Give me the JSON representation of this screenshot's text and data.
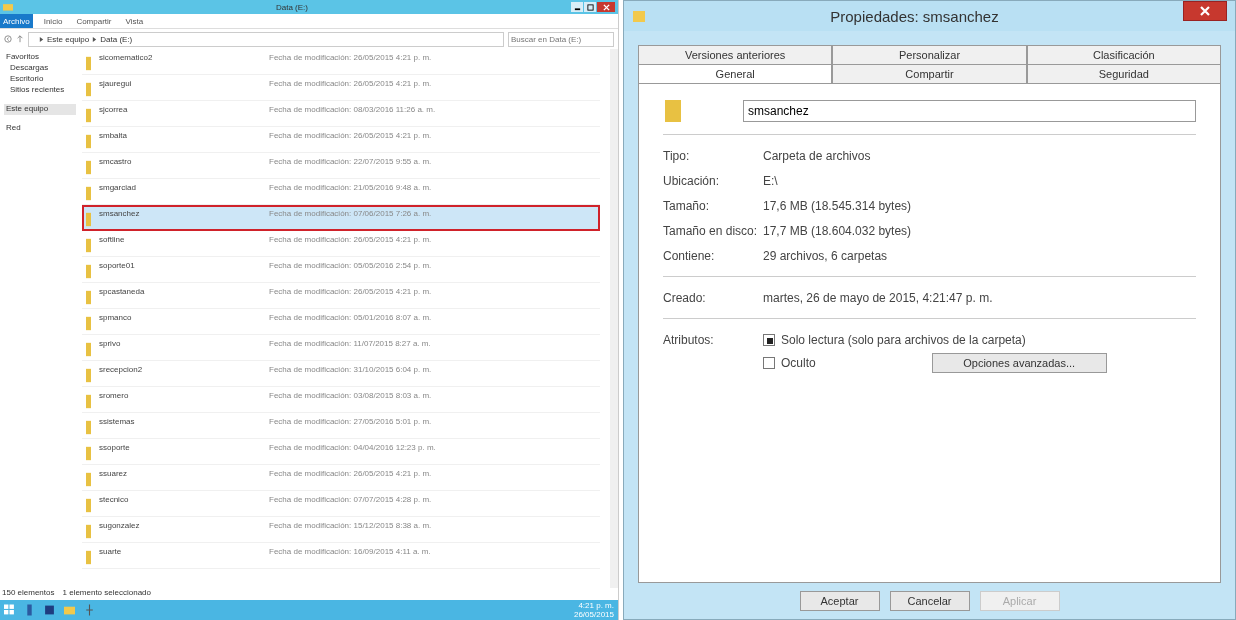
{
  "explorer": {
    "window": {
      "title": "Data (E:)"
    },
    "ribbon_tabs": [
      {
        "label": "Archivo",
        "selected": true
      },
      {
        "label": "Inicio",
        "selected": false
      },
      {
        "label": "Compartir",
        "selected": false
      },
      {
        "label": "Vista",
        "selected": false
      }
    ],
    "breadcrumb": [
      "Este equipo",
      "Data (E:)"
    ],
    "search": {
      "placeholder": "Buscar en Data (E:)"
    },
    "sidebar": {
      "items": [
        {
          "label": "Favoritos",
          "children": [
            {
              "label": "Descargas"
            },
            {
              "label": "Escritorio"
            },
            {
              "label": "Sitios recientes"
            }
          ]
        },
        {
          "label": "Este equipo",
          "selected": true
        },
        {
          "label": "Red",
          "selected": false
        }
      ]
    },
    "files": [
      {
        "name": "sicomematico2",
        "modified": "Fecha de modificación: 26/05/2015 4:21 p. m.",
        "selected": false
      },
      {
        "name": "sjauregui",
        "modified": "Fecha de modificación: 26/05/2015 4:21 p. m.",
        "selected": false
      },
      {
        "name": "sjcorrea",
        "modified": "Fecha de modificación: 08/03/2016 11:26 a. m.",
        "selected": false
      },
      {
        "name": "smbalta",
        "modified": "Fecha de modificación: 26/05/2015 4:21 p. m.",
        "selected": false
      },
      {
        "name": "smcastro",
        "modified": "Fecha de modificación: 22/07/2015 9:55 a. m.",
        "selected": false
      },
      {
        "name": "smgarciad",
        "modified": "Fecha de modificación: 21/05/2016 9:48 a. m.",
        "selected": false
      },
      {
        "name": "smsanchez",
        "modified": "Fecha de modificación: 07/06/2015 7:26 a. m.",
        "selected": true
      },
      {
        "name": "softline",
        "modified": "Fecha de modificación: 26/05/2015 4:21 p. m.",
        "selected": false
      },
      {
        "name": "soporte01",
        "modified": "Fecha de modificación: 05/05/2016 2:54 p. m.",
        "selected": false
      },
      {
        "name": "spcastaneda",
        "modified": "Fecha de modificación: 26/05/2015 4:21 p. m.",
        "selected": false
      },
      {
        "name": "spmanco",
        "modified": "Fecha de modificación: 05/01/2016 8:07 a. m.",
        "selected": false
      },
      {
        "name": "sprivo",
        "modified": "Fecha de modificación: 11/07/2015 8:27 a. m.",
        "selected": false
      },
      {
        "name": "srecepcion2",
        "modified": "Fecha de modificación: 31/10/2015 6:04 p. m.",
        "selected": false
      },
      {
        "name": "sromero",
        "modified": "Fecha de modificación: 03/08/2015 8:03 a. m.",
        "selected": false
      },
      {
        "name": "ssistemas",
        "modified": "Fecha de modificación: 27/05/2016 5:01 p. m.",
        "selected": false
      },
      {
        "name": "ssoporte",
        "modified": "Fecha de modificación: 04/04/2016 12:23 p. m.",
        "selected": false
      },
      {
        "name": "ssuarez",
        "modified": "Fecha de modificación: 26/05/2015 4:21 p. m.",
        "selected": false
      },
      {
        "name": "stecnico",
        "modified": "Fecha de modificación: 07/07/2015 4:28 p. m.",
        "selected": false
      },
      {
        "name": "sugonzalez",
        "modified": "Fecha de modificación: 15/12/2015 8:38 a. m.",
        "selected": false
      },
      {
        "name": "suarte",
        "modified": "Fecha de modificación: 16/09/2015 4:11 a. m.",
        "selected": false
      }
    ],
    "status_bar": [
      "150 elementos",
      "1 elemento seleccionado"
    ],
    "tray": {
      "time": "4:21 p. m.",
      "date": "26/05/2015"
    }
  },
  "dialog": {
    "title": "Propiedades: smsanchez",
    "tab_rows": [
      [
        {
          "label": "Versiones anteriores",
          "selected": false
        },
        {
          "label": "Personalizar",
          "selected": false
        },
        {
          "label": "Clasificación",
          "selected": false
        }
      ],
      [
        {
          "label": "General",
          "selected": true
        },
        {
          "label": "Compartir",
          "selected": false
        },
        {
          "label": "Seguridad",
          "selected": false
        }
      ]
    ],
    "name_field": {
      "value": "smsanchez"
    },
    "groups": [
      [
        {
          "label": "Tipo:",
          "value": "Carpeta de archivos"
        },
        {
          "label": "Ubicación:",
          "value": "E:\\"
        },
        {
          "label": "Tamaño:",
          "value": "17,6 MB (18.545.314 bytes)"
        },
        {
          "label": "Tamaño en disco:",
          "value": "17,7 MB (18.604.032 bytes)"
        },
        {
          "label": "Contiene:",
          "value": "29 archivos, 6 carpetas"
        }
      ],
      [
        {
          "label": "Creado:",
          "value": "martes, 26 de mayo de 2015, 4:21:47 p. m."
        }
      ]
    ],
    "attributes": {
      "label": "Atributos:",
      "items": [
        {
          "label": "Solo lectura (solo para archivos de la carpeta)",
          "checked": true
        },
        {
          "label": "Oculto",
          "checked": false
        }
      ],
      "advanced_button": "Opciones avanzadas..."
    },
    "buttons": [
      {
        "label": "Aceptar",
        "disabled": false
      },
      {
        "label": "Cancelar",
        "disabled": false
      },
      {
        "label": "Aplicar",
        "disabled": true
      }
    ]
  }
}
